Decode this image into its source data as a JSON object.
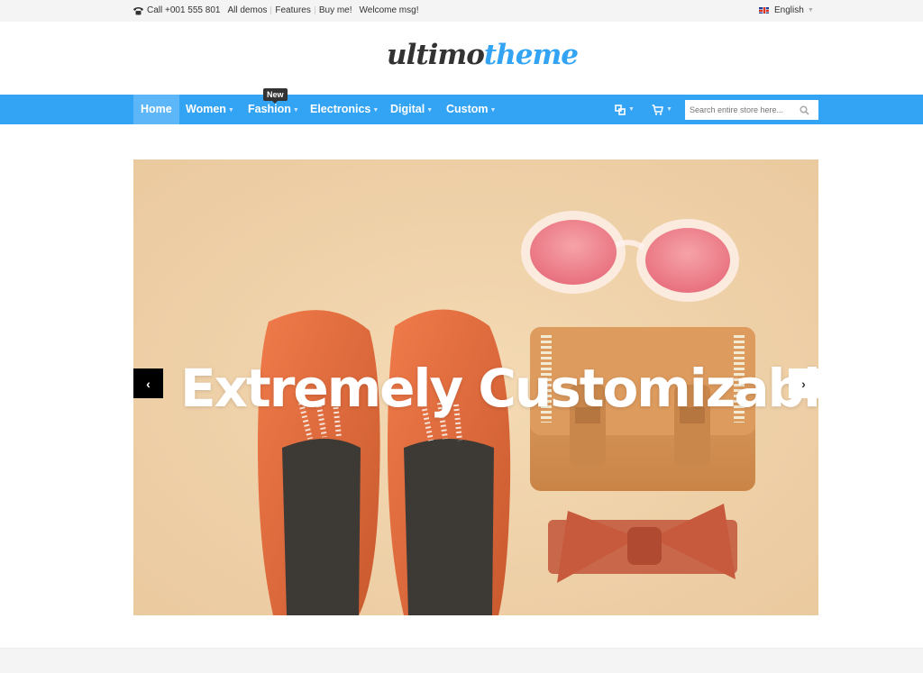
{
  "topbar": {
    "phone": "Call +001 555 801",
    "links": [
      "All demos",
      "Features",
      "Buy me!"
    ],
    "welcome": "Welcome msg!",
    "language": "English"
  },
  "logo": {
    "part1": "ultimo",
    "part2": "theme"
  },
  "nav": {
    "items": [
      "Home",
      "Women",
      "Fashion",
      "Electronics",
      "Digital",
      "Custom"
    ],
    "badge": "New",
    "search_placeholder": "Search entire store here..."
  },
  "slider": {
    "headline": "Extremely Customizable"
  },
  "icons": {
    "phone": "phone-icon",
    "compare": "compare-icon",
    "cart": "cart-icon",
    "search": "search-icon",
    "prev": "chevron-left-icon",
    "next": "chevron-right-icon"
  },
  "colors": {
    "accent": "#33a3f4",
    "dark": "#333333",
    "slide_bg": "#f0d2a8"
  }
}
